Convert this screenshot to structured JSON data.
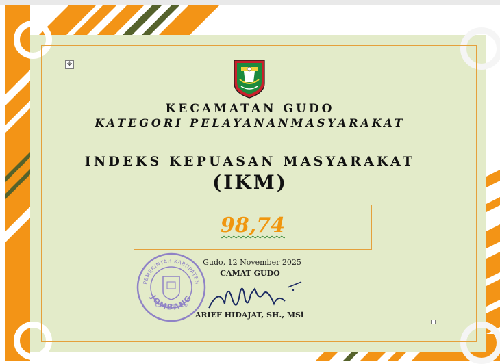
{
  "certificate": {
    "district": "KECAMATAN GUDO",
    "category": "KATEGORI PELAYANANMASYARAKAT",
    "index_title": "INDEKS KEPUASAN MASYARAKAT",
    "index_abbr": "(IKM)",
    "score": "98,74",
    "place_date": "Gudo, 12 November 2025",
    "position": "CAMAT GUDO",
    "official_name": "ARIEF HIDAJAT, SH., MSi"
  },
  "stamp": {
    "top_text": "PEMERINTAH KABUPATEN",
    "middle_text": "KECAMATAN GUDO",
    "bottom_text": "JOMBANG"
  },
  "icons": {
    "move_handle": "move-handle-icon",
    "logo": "jombang-regency-emblem-icon"
  },
  "colors": {
    "accent_orange": "#f39416",
    "stripe_green": "#55622b",
    "paper": "#e3ebc9",
    "frame": "#e5a03b",
    "stamp": "#8f82c6"
  }
}
